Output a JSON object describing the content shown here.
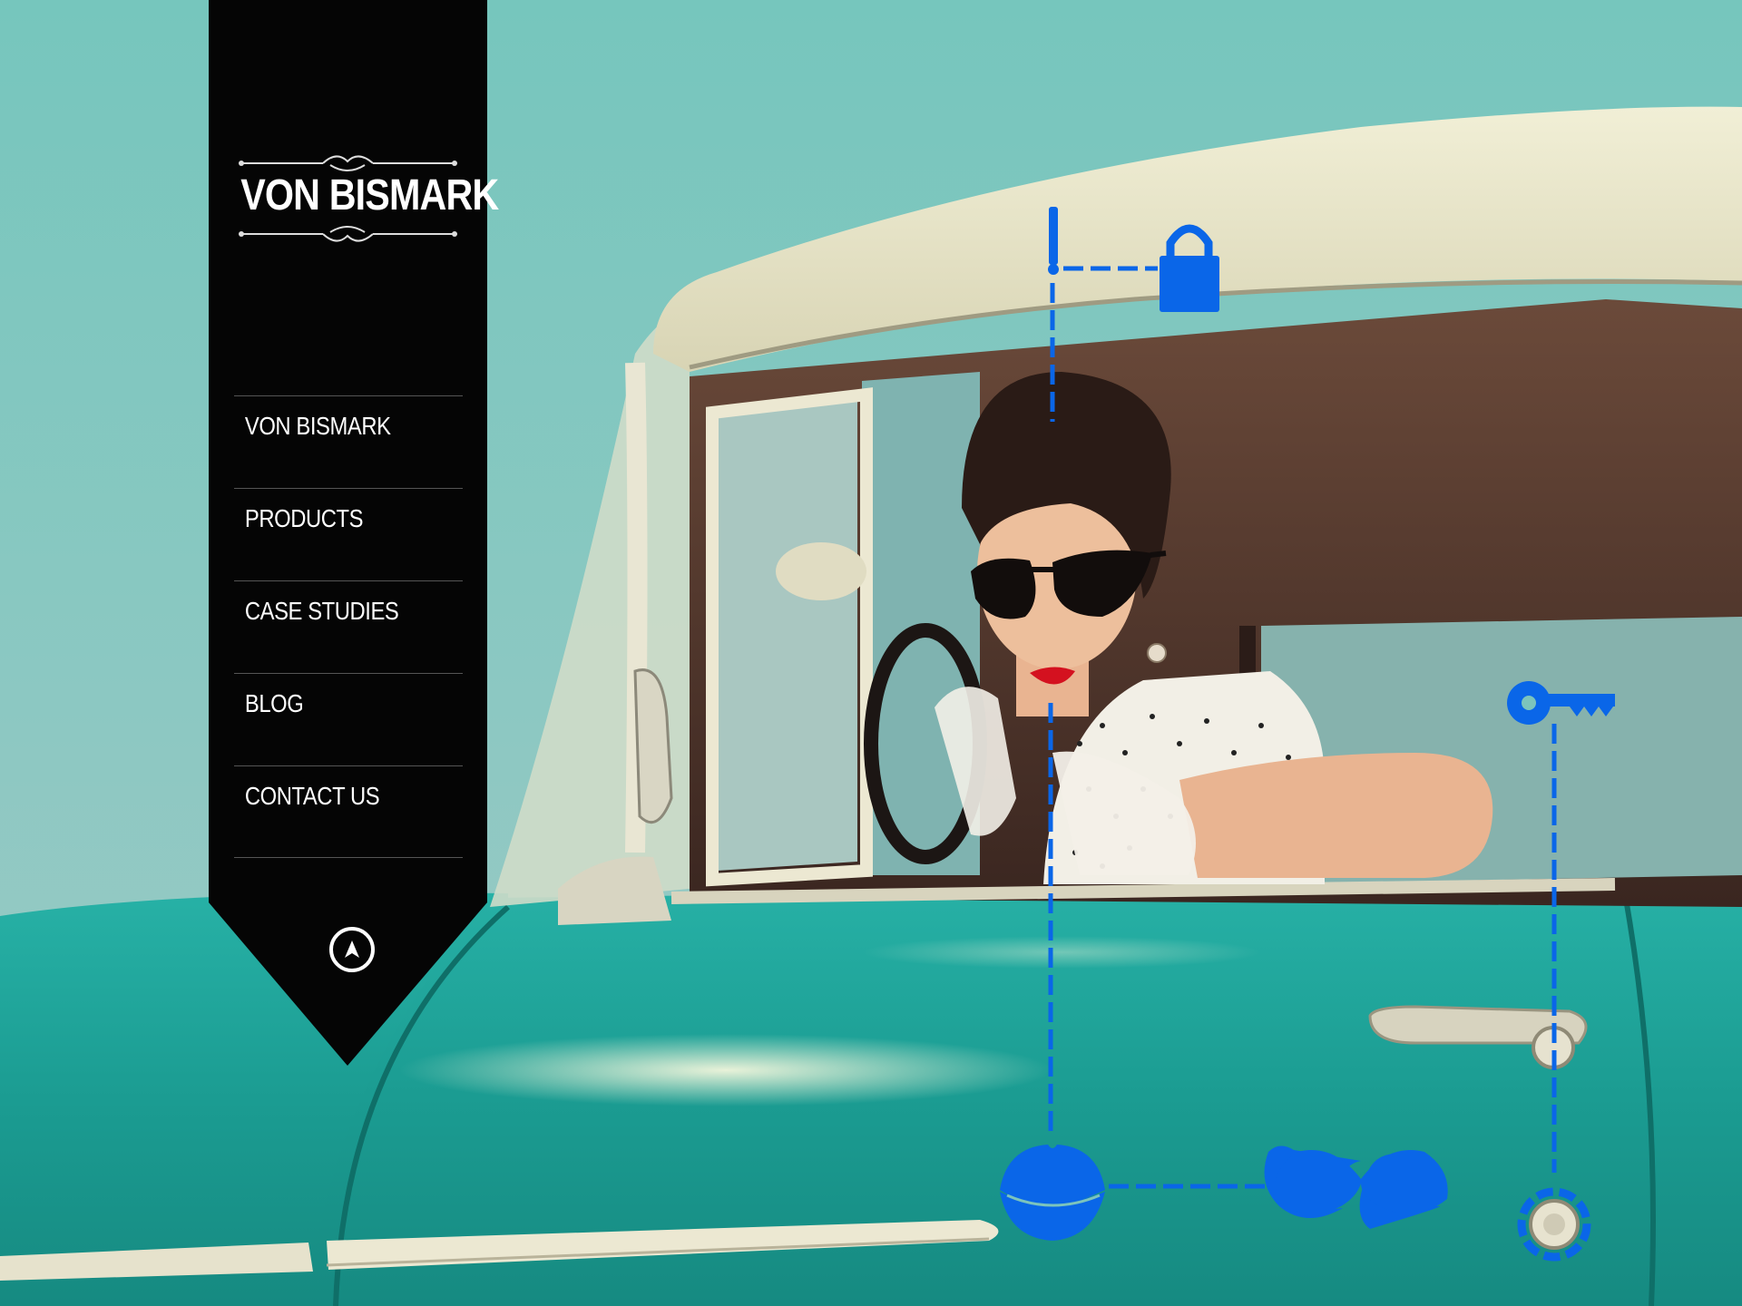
{
  "brand": {
    "logo_text": "VON BISMARK"
  },
  "nav": {
    "items": [
      {
        "label": "VON BISMARK"
      },
      {
        "label": "PRODUCTS"
      },
      {
        "label": "CASE STUDIES"
      },
      {
        "label": "BLOG"
      },
      {
        "label": "CONTACT US"
      }
    ]
  },
  "icons": {
    "compass": "compass-icon",
    "overlay": [
      "exclamation-icon",
      "padlock-icon",
      "key-icon",
      "lips-icon",
      "mustache-icon",
      "keyhole-icon"
    ]
  },
  "colors": {
    "sidebar": "#050505",
    "accent_blue": "#0a66e8",
    "sky": "#7cc4bc",
    "car_teal": "#1fa39a",
    "car_roof": "#e8e4c6"
  }
}
